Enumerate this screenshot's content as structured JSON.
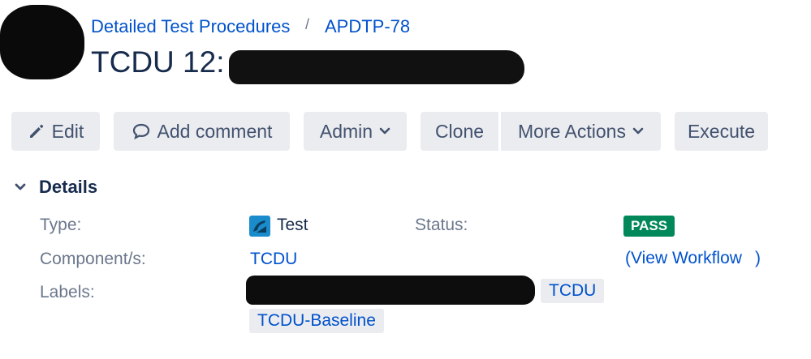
{
  "breadcrumb": {
    "project": "Detailed Test Procedures",
    "separator": "/",
    "issue_key": "APDTP-78"
  },
  "page_title": "TCDU 12:",
  "toolbar": {
    "edit": "Edit",
    "add_comment": "Add comment",
    "admin": "Admin",
    "clone": "Clone",
    "more_actions": "More Actions",
    "execute": "Execute"
  },
  "details": {
    "section_title": "Details",
    "type_label": "Type:",
    "type_value": "Test",
    "status_label": "Status:",
    "status_value": "PASS",
    "components_label": "Component/s:",
    "components_value": "TCDU",
    "view_workflow_open": "(",
    "view_workflow": "View Workflow",
    "view_workflow_close": ")",
    "labels_label": "Labels:",
    "labels": [
      "TCDU",
      "TCDU-Baseline"
    ]
  },
  "colors": {
    "link": "#0052cc",
    "status_pass": "#00875a",
    "button_bg": "#ebecf0"
  }
}
